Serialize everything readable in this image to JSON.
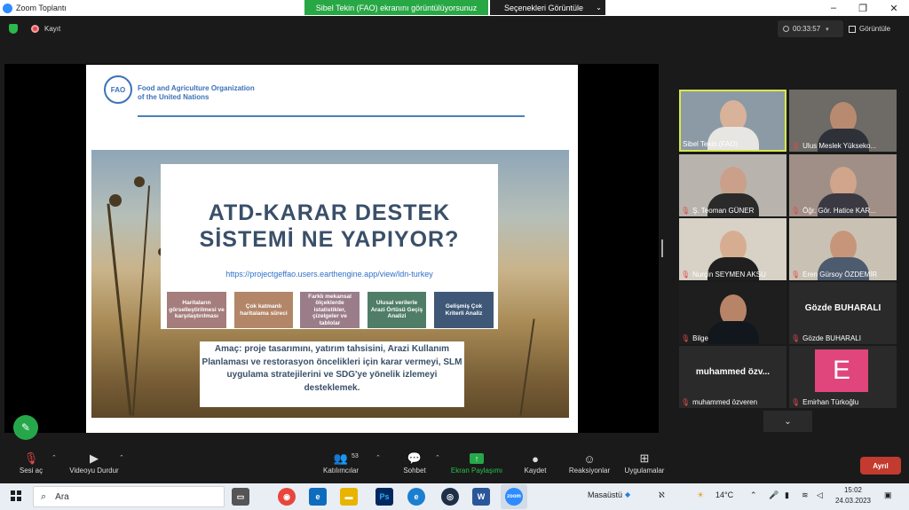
{
  "window": {
    "title": "Zoom Toplantı",
    "share_banner": "Sibel Tekin (FAO) ekranını görüntülüyorsunuz",
    "view_options": "Seçenekleri Görüntüle"
  },
  "topbar": {
    "record_label": "Kayıt",
    "timer": "00:33:57",
    "view_label": "Görüntüle"
  },
  "slide": {
    "org_line1": "Food and Agriculture Organization",
    "org_line2": "of the United Nations",
    "logo_text": "FAO",
    "headline_line1": "ATD-KARAR DESTEK",
    "headline_line2": "SİSTEMİ NE YAPIYOR?",
    "link": "https://projectgeffao.users.earthengine.app/view/ldn-turkey",
    "features": [
      {
        "label": "Haritaların görselleştirilmesi ve karşılaştırılması",
        "color": "#a57d7c"
      },
      {
        "label": "Çok katmanlı haritalama süreci",
        "color": "#b38668"
      },
      {
        "label": "Farklı mekansal ölçeklerde istatistikler, çizelgeler ve tablolar",
        "color": "#9b7d8a"
      },
      {
        "label": "Ulusal verilerle Arazi Örtüsü Geçiş Analizi",
        "color": "#4f7d67"
      },
      {
        "label": "Gelişmiş Çok Kriterli Analiz",
        "color": "#3f5877"
      }
    ],
    "goal": "Amaç: proje tasarımını, yatırım tahsisini, Arazi Kullanım Planlaması ve restorasyon öncelikleri için karar vermeyi, SLM uygulama stratejilerini ve SDG'ye yönelik izlemeyi desteklemek."
  },
  "participants": [
    {
      "name": "Sibel Tekin (FAO)",
      "muted": false,
      "active": true,
      "video": true,
      "bg": "#8c9aa6",
      "skin": "#d9b29a",
      "shirt": "#e8e6e2"
    },
    {
      "name": "Ulus Meslek Yükseko...",
      "muted": true,
      "active": false,
      "video": true,
      "bg": "#6e6a66",
      "skin": "#b88b70",
      "shirt": "#2e3138"
    },
    {
      "name": "Ş. Teoman GÜNER",
      "muted": true,
      "active": false,
      "video": true,
      "bg": "#b8b4ad",
      "skin": "#caa08a",
      "shirt": "#2a2a2a"
    },
    {
      "name": "Öğr. Gör. Hatice KAR...",
      "muted": true,
      "active": false,
      "video": true,
      "bg": "#a08f86",
      "skin": "#d1a48c",
      "shirt": "#3b3a42"
    },
    {
      "name": "Nurçin SEYMEN AKSU",
      "muted": true,
      "active": false,
      "video": true,
      "bg": "#d7d1c6",
      "skin": "#d7ad92",
      "shirt": "#1f1f1f"
    },
    {
      "name": "Eren Gürsoy ÖZDEMİR",
      "muted": true,
      "active": false,
      "video": true,
      "bg": "#c9c2b4",
      "skin": "#c7967a",
      "shirt": "#4d5b6e"
    },
    {
      "name": "Bilge",
      "muted": true,
      "active": false,
      "video": true,
      "bg": "#1e1e1e",
      "skin": "#b88468",
      "shirt": "#12161d"
    },
    {
      "name": "Gözde BUHARALI",
      "muted": true,
      "active": false,
      "video": false,
      "big": "Gözde BUHARALI"
    },
    {
      "name": "muhammed özveren",
      "muted": true,
      "active": false,
      "video": false,
      "big": "muhammed özv..."
    },
    {
      "name": "Emirhan Türkoğlu",
      "muted": true,
      "active": false,
      "video": false,
      "avatar": "E"
    }
  ],
  "toolbar": {
    "unmute": "Sesi aç",
    "stop_video": "Videoyu Durdur",
    "participants": "Katılımcılar",
    "participants_count": "53",
    "chat": "Sohbet",
    "share": "Ekran Paylaşımı",
    "record": "Kaydet",
    "reactions": "Reaksiyonlar",
    "apps": "Uygulamalar",
    "leave": "Ayrıl"
  },
  "taskbar": {
    "search": "Ara",
    "desktop": "Masaüstü",
    "weather": "14°C",
    "time": "15:02",
    "date": "24.03.2023"
  }
}
